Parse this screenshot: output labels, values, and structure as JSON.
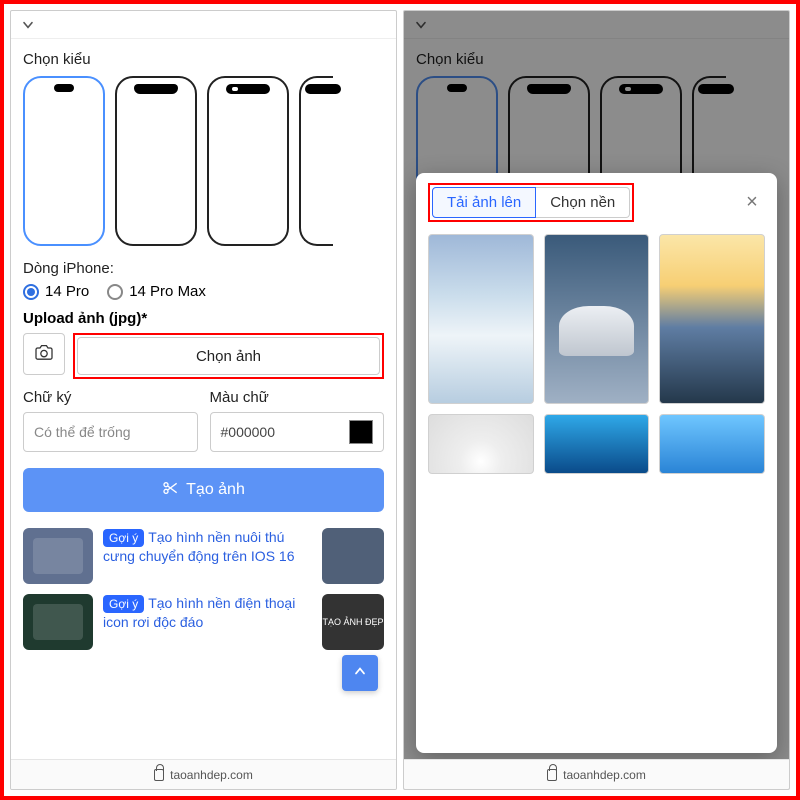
{
  "left": {
    "choose_style_label": "Chọn kiểu",
    "iphone_line_label": "Dòng iPhone:",
    "radio_14pro": "14 Pro",
    "radio_14promax": "14 Pro Max",
    "upload_label": "Upload ảnh (jpg)*",
    "choose_image_btn": "Chọn ảnh",
    "signature_label": "Chữ ký",
    "signature_placeholder": "Có thể để trống",
    "color_label": "Màu chữ",
    "color_value": "#000000",
    "create_btn": "Tạo ảnh",
    "suggestion_pill": "Gợi ý",
    "sugg1": "Tạo hình nền nuôi thú cưng chuyển động trên IOS 16",
    "sugg2": "Tạo hình nền điện thoại icon rơi độc đáo",
    "sugg2_thumb_text": "TẠO ẢNH ĐẸP"
  },
  "right": {
    "tab_upload": "Tải ảnh lên",
    "tab_choose_bg": "Chọn nền"
  },
  "footer_domain": "taoanhdep.com"
}
